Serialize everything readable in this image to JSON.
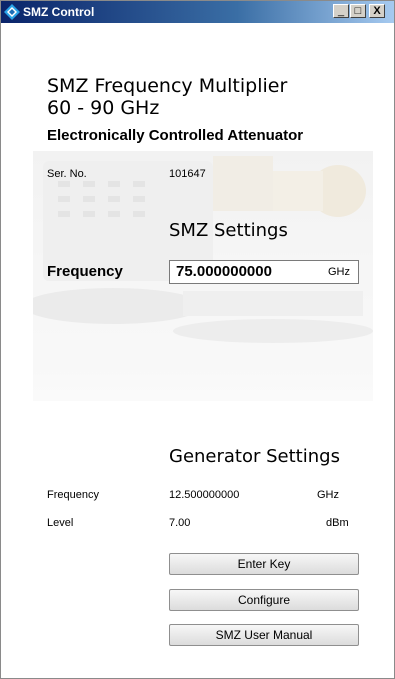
{
  "window": {
    "title": "SMZ Control",
    "buttons": {
      "minimize": "_",
      "maximize": "□",
      "close": "X"
    }
  },
  "header": {
    "product_line1": "SMZ Frequency Multiplier",
    "product_line2": "60 - 90 GHz",
    "subtitle": "Electronically Controlled Attenuator"
  },
  "serial": {
    "label": "Ser. No.",
    "value": "101647"
  },
  "smz_settings": {
    "title": "SMZ Settings",
    "frequency_label": "Frequency",
    "frequency_value": "75.000000000",
    "frequency_unit": "GHz"
  },
  "generator_settings": {
    "title": "Generator Settings",
    "frequency_label": "Frequency",
    "frequency_value": "12.500000000",
    "frequency_unit": "GHz",
    "level_label": "Level",
    "level_value": "7.00",
    "level_unit": "dBm"
  },
  "buttons": {
    "enter_key": "Enter Key",
    "configure": "Configure",
    "user_manual": "SMZ User Manual"
  },
  "colors": {
    "titlebar_start": "#0a246a",
    "titlebar_end": "#a6caf0"
  }
}
